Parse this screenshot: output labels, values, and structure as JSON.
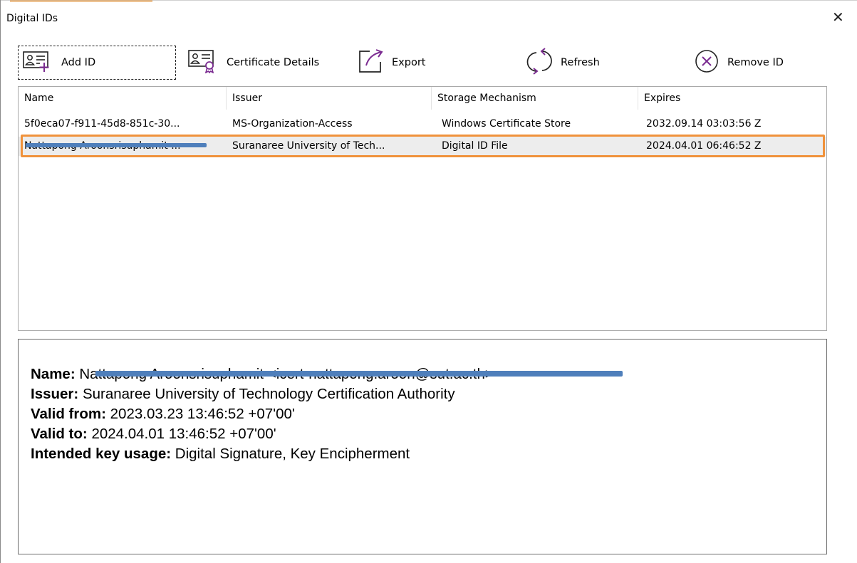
{
  "window": {
    "title": "Digital IDs",
    "close_glyph": "✕"
  },
  "toolbar": {
    "add_id": {
      "label": "Add ID",
      "icon": "id-card-add-icon"
    },
    "certificate_details": {
      "label": "Certificate Details",
      "icon": "id-card-certificate-icon"
    },
    "export": {
      "label": "Export",
      "icon": "export-arrow-icon"
    },
    "refresh": {
      "label": "Refresh",
      "icon": "refresh-icon"
    },
    "remove_id": {
      "label": "Remove ID",
      "icon": "remove-circle-x-icon"
    }
  },
  "table": {
    "columns": [
      "Name",
      "Issuer",
      "Storage Mechanism",
      "Expires"
    ],
    "rows": [
      {
        "name": "5f0eca07-f911-45d8-851c-30...",
        "issuer": "MS-Organization-Access",
        "storage": "Windows Certificate Store",
        "expires": "2032.09.14 03:03:56 Z",
        "selected": false
      },
      {
        "name": "Nattapong Aroonsrisuphamit ...",
        "issuer": "Suranaree University of Tech...",
        "storage": "Digital ID File",
        "expires": "2024.04.01 06:46:52 Z",
        "selected": true
      }
    ]
  },
  "details": {
    "name_label": "Name:",
    "name_value": "Nattapong Aroonsrisuphamit <icert-nattapong.aroon@sut.ac.th>",
    "issuer_label": "Issuer:",
    "issuer_value": "Suranaree University of Technology Certification Authority",
    "valid_from_label": "Valid from:",
    "valid_from_value": "2023.03.23 13:46:52 +07'00'",
    "valid_to_label": "Valid to:",
    "valid_to_value": "2024.04.01 13:46:52 +07'00'",
    "key_usage_label": "Intended key usage:",
    "key_usage_value": "Digital Signature, Key Encipherment"
  },
  "colors": {
    "accent_purple": "#7b2c91",
    "selection_outline": "#f0923b",
    "redaction_blue": "#4f7fbb"
  }
}
